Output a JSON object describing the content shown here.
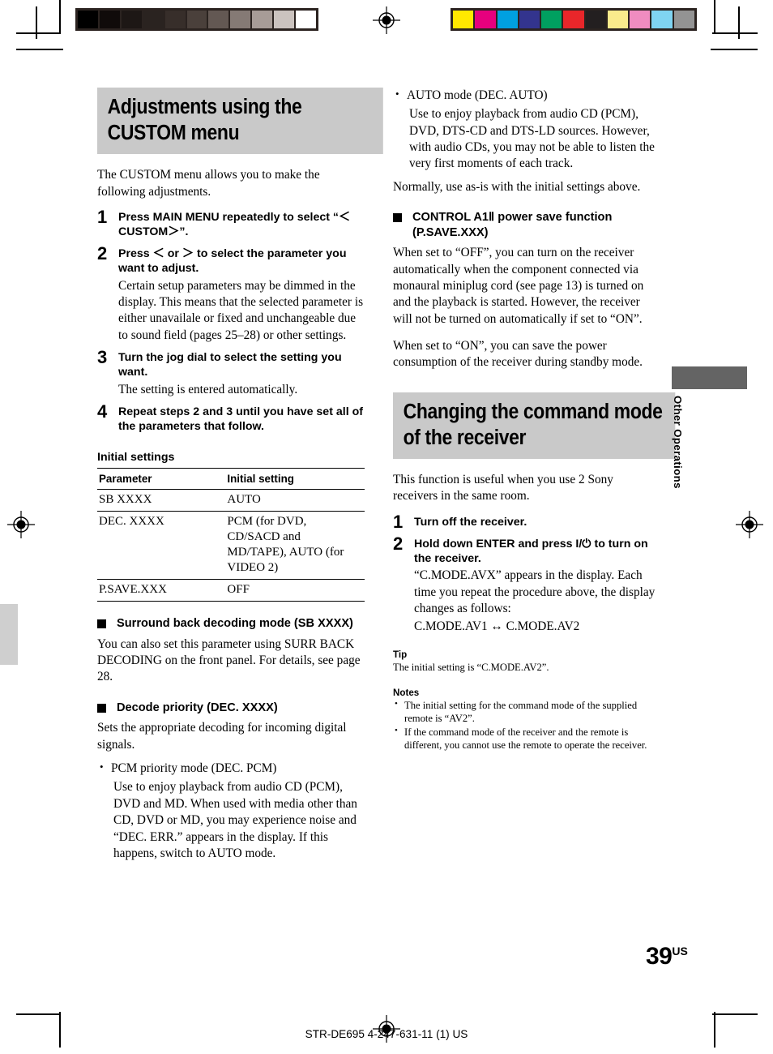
{
  "document": {
    "page_number": "39",
    "page_number_suffix": "US",
    "footer_code": "STR-DE695 4-247-631-11 (1) US",
    "side_tab_label": "Other Operations"
  },
  "calibration": {
    "grayscale_swatches": [
      "#000000",
      "#100b0a",
      "#1d1715",
      "#2a2320",
      "#372e2a",
      "#4a403b",
      "#635853",
      "#857a75",
      "#a79c97",
      "#cbc3bf",
      "#ffffff"
    ],
    "color_swatches": [
      "#ffe800",
      "#e6007e",
      "#00a0e0",
      "#33348e",
      "#00a060",
      "#e8262a",
      "#231f20",
      "#faeb8c",
      "#f08cc0",
      "#7fd4f2",
      "#939393"
    ]
  },
  "left_column": {
    "heading": "Adjustments using the CUSTOM menu",
    "intro": "The CUSTOM menu allows you to make the following adjustments.",
    "steps": [
      {
        "num": "1",
        "text": "Press MAIN MENU repeatedly to select “＜CUSTOM＞”.",
        "sub": ""
      },
      {
        "num": "2",
        "text": "Press ＜ or ＞ to select the parameter you want to adjust.",
        "sub": "Certain setup parameters may be dimmed in the display. This means that the selected parameter is either unavailale or fixed and unchangeable due to sound field (pages 25–28) or other settings."
      },
      {
        "num": "3",
        "text": "Turn the jog dial to select the setting you want.",
        "sub": "The setting is entered automatically."
      },
      {
        "num": "4",
        "text": "Repeat steps 2 and 3 until you have set all of the parameters that follow.",
        "sub": ""
      }
    ],
    "table": {
      "caption": "Initial settings",
      "headers": [
        "Parameter",
        "Initial setting"
      ],
      "rows": [
        [
          "SB XXXX",
          "AUTO"
        ],
        [
          "DEC. XXXX",
          "PCM (for  DVD, CD/SACD and MD/TAPE), AUTO (for VIDEO 2)"
        ],
        [
          "P.SAVE.XXX",
          "OFF"
        ]
      ]
    },
    "subsection_1": {
      "heading": "Surround back decoding mode (SB XXXX)",
      "body": "You can also set this parameter using SURR BACK DECODING on the front panel. For details, see page 28."
    },
    "subsection_2": {
      "heading": "Decode priority (DEC. XXXX)",
      "body": "Sets the appropriate decoding for incoming digital signals.",
      "bullet_title": "PCM priority mode (DEC. PCM)",
      "bullet_body": "Use to enjoy playback from audio CD (PCM), DVD and MD. When used with media other than CD, DVD or MD, you may experience noise and “DEC. ERR.” appears in the display. If this happens, switch to AUTO mode."
    }
  },
  "right_column": {
    "auto_mode": {
      "bullet_title": "AUTO mode (DEC. AUTO)",
      "bullet_body": "Use to enjoy playback from audio CD (PCM), DVD, DTS-CD and DTS-LD sources. However, with audio CDs, you may not be able to listen the very first moments of each track.",
      "closing": "Normally, use as-is with the initial settings above."
    },
    "power_save": {
      "heading": "CONTROL A1Ⅱ power save function (P.SAVE.XXX)",
      "paragraph_1": "When set to “OFF”, you can turn on the receiver automatically when the component connected via monaural miniplug cord (see page 13) is turned on and the playback is started. However, the receiver will not be turned on automatically if set to “ON”.",
      "paragraph_2": "When set to “ON”, you can save the power consumption of the receiver during standby mode."
    },
    "command_mode": {
      "heading": "Changing the command mode of the receiver",
      "intro": "This function is useful when you use 2 Sony receivers in the same room.",
      "steps": [
        {
          "num": "1",
          "text": "Turn off the receiver.",
          "sub": ""
        },
        {
          "num": "2",
          "text": "Hold down ENTER and press I/⏻ to turn on the receiver.",
          "sub": "“C.MODE.AVX” appears in the display. Each time you repeat the procedure above, the display changes as follows:",
          "sub2": "C.MODE.AV1 ↔ C.MODE.AV2"
        }
      ],
      "tip_label": "Tip",
      "tip_text": "The initial setting is “C.MODE.AV2”.",
      "notes_label": "Notes",
      "notes": [
        "The initial setting for the command mode of the supplied remote is “AV2”.",
        "If the command mode of the receiver and the remote is different, you cannot use the remote to operate the receiver."
      ]
    }
  },
  "colors": {
    "banner_bg": "#c9c9c9",
    "tab_block": "#646464",
    "ink": "#000000"
  }
}
